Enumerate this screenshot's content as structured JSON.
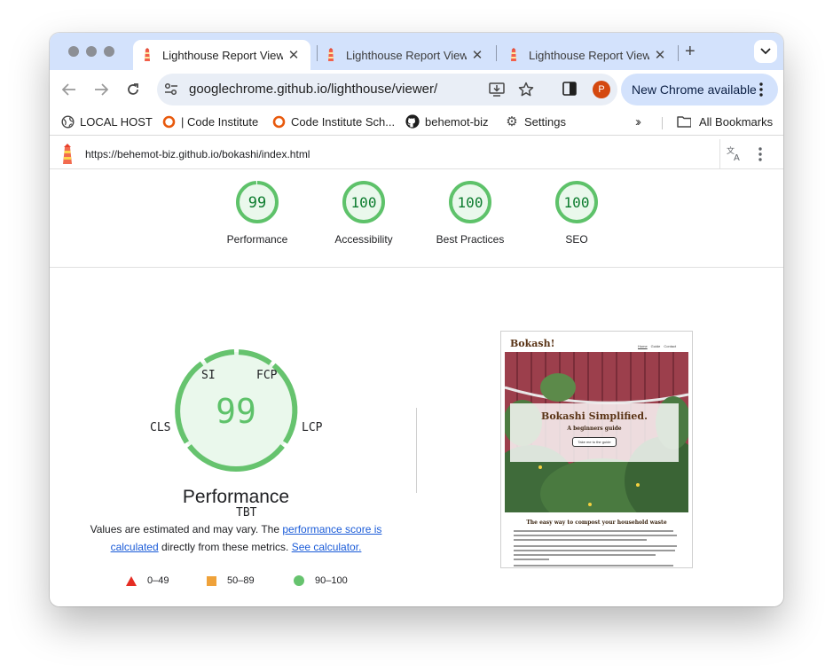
{
  "tabs": [
    {
      "title": "Lighthouse Report Viewer",
      "active": true
    },
    {
      "title": "Lighthouse Report Viewer",
      "active": false
    },
    {
      "title": "Lighthouse Report Viewer",
      "active": false
    }
  ],
  "toolbar": {
    "url": "googlechrome.github.io/lighthouse/viewer/",
    "profile_initial": "P",
    "update_label": "New Chrome available"
  },
  "bookmarks": {
    "items": [
      {
        "label": "LOCAL HOST",
        "icon": "globe-icon"
      },
      {
        "label": "| Code Institute",
        "icon": "code-institute-icon"
      },
      {
        "label": "Code Institute Sch...",
        "icon": "code-institute-icon"
      },
      {
        "label": "behemot-biz",
        "icon": "github-icon"
      },
      {
        "label": "Settings",
        "icon": "gear-icon"
      }
    ],
    "all_bookmarks": "All Bookmarks"
  },
  "report": {
    "url": "https://behemot-biz.github.io/bokashi/index.html",
    "categories": [
      {
        "score": "99",
        "label": "Performance",
        "fraction": 0.99
      },
      {
        "score": "100",
        "label": "Accessibility",
        "fraction": 1.0
      },
      {
        "score": "100",
        "label": "Best Practices",
        "fraction": 1.0
      },
      {
        "score": "100",
        "label": "SEO",
        "fraction": 1.0
      }
    ],
    "performance": {
      "score": "99",
      "title": "Performance",
      "metrics": [
        "SI",
        "FCP",
        "LCP",
        "TBT",
        "CLS"
      ],
      "note_prefix": "Values are estimated and may vary. The ",
      "note_link1": "performance score is calculated",
      "note_middle": " directly from these metrics. ",
      "note_link2": "See calculator."
    },
    "legend": [
      {
        "range": "0–49",
        "shape": "triangle",
        "color": "#e52d23"
      },
      {
        "range": "50–89",
        "shape": "square",
        "color": "#efa23a"
      },
      {
        "range": "90–100",
        "shape": "circle",
        "color": "#66c36e"
      }
    ],
    "screenshot": {
      "brand": "Bokash!",
      "nav": [
        "Home",
        "Guide",
        "Contact"
      ],
      "hero_title": "Bokashi Simplified.",
      "hero_subtitle": "A beginners guide",
      "hero_button": "Take me to the guide",
      "section_title": "The easy way to compost your household waste"
    }
  },
  "colors": {
    "pass_green": "#0c7c2e",
    "pass_ring": "#5ec26a",
    "pass_fill": "#eaf8ec",
    "link_blue": "#1a5bd8",
    "tab_strip": "#d3e2fc"
  }
}
